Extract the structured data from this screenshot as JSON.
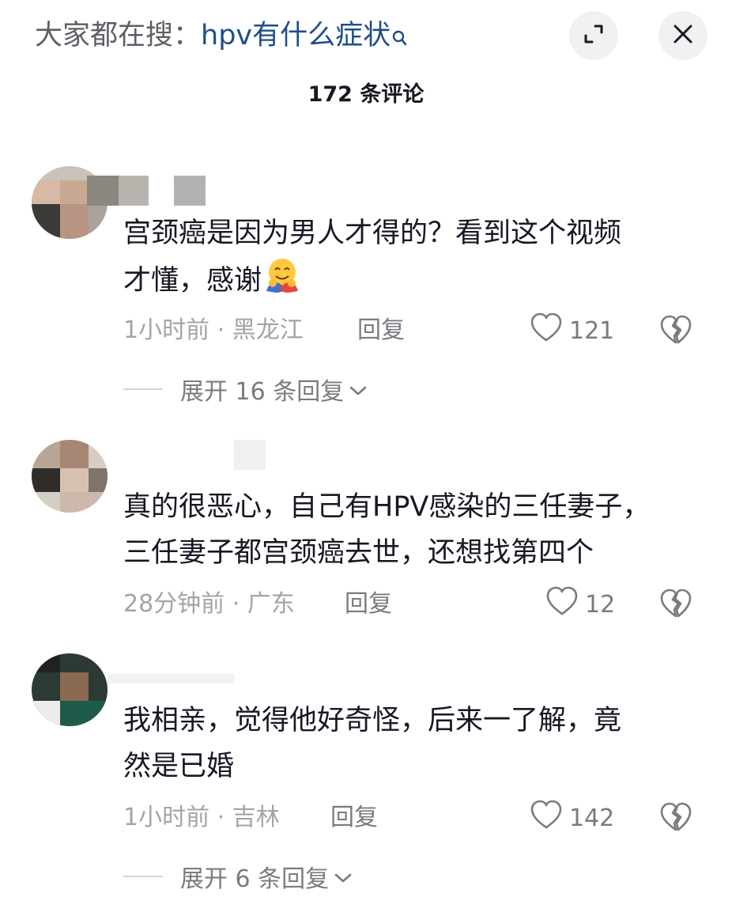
{
  "header": {
    "search_prefix": "大家都在搜：",
    "search_term": "hpv有什么症状",
    "search_icon": "search-icon",
    "expand_icon": "expand-icon",
    "close_icon": "close-icon"
  },
  "comments_count_label": "172 条评论",
  "comments": [
    {
      "text_line1": "宫颈癌是因为男人才得的？看到这个视频",
      "text_line2": "才懂，感谢",
      "emoji": "hugging-emoji",
      "time": "1小时前",
      "separator": "·",
      "location": "黑龙江",
      "reply_label": "回复",
      "likes": "121",
      "expand_label": "展开 16 条回复"
    },
    {
      "text_line1": "真的很恶心，自己有HPV感染的三任妻子，",
      "text_line2": "三任妻子都宫颈癌去世，还想找第四个",
      "time": "28分钟前",
      "separator": "·",
      "location": "广东",
      "reply_label": "回复",
      "likes": "12"
    },
    {
      "text_line1": "我相亲，觉得他好奇怪，后来一了解，竟",
      "text_line2": "然是已婚",
      "time": "1小时前",
      "separator": "·",
      "location": "吉林",
      "reply_label": "回复",
      "likes": "142",
      "expand_label": "展开 6 条回复"
    }
  ],
  "colors": {
    "text": "#161823",
    "meta": "#a3a4a8",
    "action": "#7a7b80",
    "search_term": "#1f4e8a"
  }
}
